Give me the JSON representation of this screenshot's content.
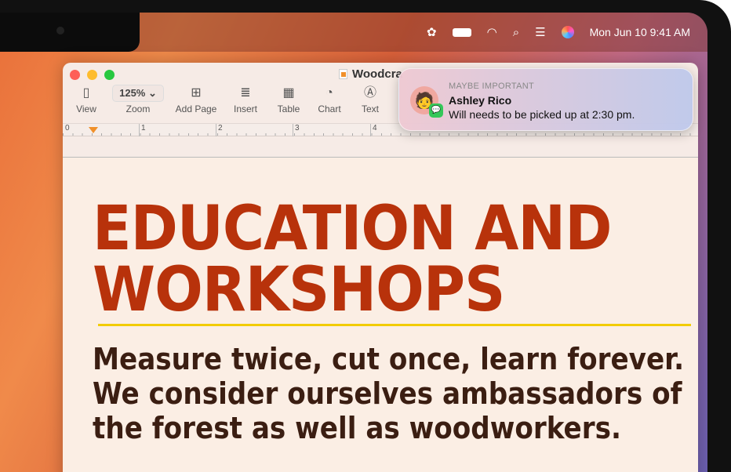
{
  "menubar": {
    "datetime": "Mon Jun 10  9:41 AM",
    "icons": [
      "gear-icon",
      "battery-icon",
      "wifi-icon",
      "search-icon",
      "control-center-icon",
      "siri-icon"
    ]
  },
  "window": {
    "title": "Woodcra",
    "toolbar": {
      "view": "View",
      "zoom_value": "125%",
      "zoom": "Zoom",
      "add_page": "Add Page",
      "insert": "Insert",
      "table": "Table",
      "chart": "Chart",
      "text": "Text"
    },
    "ruler": [
      "0",
      "1",
      "2",
      "3",
      "4"
    ]
  },
  "document": {
    "heading_line1": "EDUCATION AND",
    "heading_line2": "WORKSHOPS",
    "body_lines": [
      "Measure twice, cut once, learn forever.",
      "We consider ourselves ambassadors of",
      "the forest as well as woodworkers."
    ],
    "heading_color": "#b8320b",
    "rule_color": "#f2cc00"
  },
  "notification": {
    "category": "MAYBE IMPORTANT",
    "sender": "Ashley Rico",
    "message": "Will needs to be picked up at 2:30 pm.",
    "app_icon": "messages-icon"
  }
}
